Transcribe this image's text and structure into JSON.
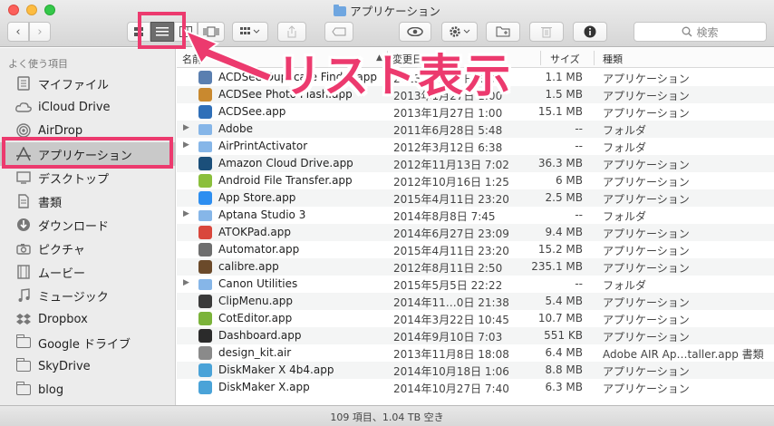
{
  "window": {
    "title": "アプリケーション"
  },
  "toolbar": {
    "search_placeholder": "検索",
    "back_glyph": "‹",
    "forward_glyph": "›",
    "view_modes": [
      "icon",
      "list",
      "column",
      "cover-flow"
    ],
    "active_view": "list"
  },
  "sidebar": {
    "heading": "よく使う項目",
    "items": [
      {
        "label": "マイファイル",
        "icon": "all-files-icon"
      },
      {
        "label": "iCloud Drive",
        "icon": "cloud-icon"
      },
      {
        "label": "AirDrop",
        "icon": "airdrop-icon"
      },
      {
        "label": "アプリケーション",
        "icon": "applications-icon",
        "selected": true
      },
      {
        "label": "デスクトップ",
        "icon": "desktop-icon"
      },
      {
        "label": "書類",
        "icon": "documents-icon"
      },
      {
        "label": "ダウンロード",
        "icon": "downloads-icon"
      },
      {
        "label": "ピクチャ",
        "icon": "camera-icon"
      },
      {
        "label": "ムービー",
        "icon": "film-icon"
      },
      {
        "label": "ミュージック",
        "icon": "music-icon"
      },
      {
        "label": "Dropbox",
        "icon": "dropbox-icon"
      },
      {
        "label": "Google ドライブ",
        "icon": "folder-icon"
      },
      {
        "label": "SkyDrive",
        "icon": "folder-icon"
      },
      {
        "label": "blog",
        "icon": "folder-icon"
      }
    ]
  },
  "columns": {
    "name": "名前",
    "date": "変更日",
    "size": "サイズ",
    "kind": "種類"
  },
  "files": [
    {
      "name": "ACDSee Duplicate Finder.app",
      "date": "2013年1月27日 1:00",
      "size": "1.1 MB",
      "kind": "アプリケーション",
      "icon": "#5a7fb0",
      "folder": false
    },
    {
      "name": "ACDSee Photo Flash.app",
      "date": "2013年1月27日 1:00",
      "size": "1.5 MB",
      "kind": "アプリケーション",
      "icon": "#c9892f",
      "folder": false
    },
    {
      "name": "ACDSee.app",
      "date": "2013年1月27日 1:00",
      "size": "15.1 MB",
      "kind": "アプリケーション",
      "icon": "#2f6fb8",
      "folder": false
    },
    {
      "name": "Adobe",
      "date": "2011年6月28日 5:48",
      "size": "--",
      "kind": "フォルダ",
      "folder": true
    },
    {
      "name": "AirPrintActivator",
      "date": "2012年3月12日 6:38",
      "size": "--",
      "kind": "フォルダ",
      "folder": true
    },
    {
      "name": "Amazon Cloud Drive.app",
      "date": "2012年11月13日 7:02",
      "size": "36.3 MB",
      "kind": "アプリケーション",
      "icon": "#1b4f7a",
      "folder": false
    },
    {
      "name": "Android File Transfer.app",
      "date": "2012年10月16日 1:25",
      "size": "6 MB",
      "kind": "アプリケーション",
      "icon": "#8bbf3c",
      "folder": false
    },
    {
      "name": "App Store.app",
      "date": "2015年4月11日 23:20",
      "size": "2.5 MB",
      "kind": "アプリケーション",
      "icon": "#2d8ef0",
      "folder": false
    },
    {
      "name": "Aptana Studio 3",
      "date": "2014年8月8日 7:45",
      "size": "--",
      "kind": "フォルダ",
      "folder": true
    },
    {
      "name": "ATOKPad.app",
      "date": "2014年6月27日 23:09",
      "size": "9.4 MB",
      "kind": "アプリケーション",
      "icon": "#d9473c",
      "folder": false
    },
    {
      "name": "Automator.app",
      "date": "2015年4月11日 23:20",
      "size": "15.2 MB",
      "kind": "アプリケーション",
      "icon": "#6e6e6e",
      "folder": false
    },
    {
      "name": "calibre.app",
      "date": "2012年8月11日 2:50",
      "size": "235.1 MB",
      "kind": "アプリケーション",
      "icon": "#6b4a2a",
      "folder": false
    },
    {
      "name": "Canon Utilities",
      "date": "2015年5月5日 22:22",
      "size": "--",
      "kind": "フォルダ",
      "folder": true
    },
    {
      "name": "ClipMenu.app",
      "date": "2014年11…0日 21:38",
      "size": "5.4 MB",
      "kind": "アプリケーション",
      "icon": "#3a3a3a",
      "folder": false
    },
    {
      "name": "CotEditor.app",
      "date": "2014年3月22日 10:45",
      "size": "10.7 MB",
      "kind": "アプリケーション",
      "icon": "#7bb33a",
      "folder": false
    },
    {
      "name": "Dashboard.app",
      "date": "2014年9月10日 7:03",
      "size": "551 KB",
      "kind": "アプリケーション",
      "icon": "#2b2b2b",
      "folder": false
    },
    {
      "name": "design_kit.air",
      "date": "2013年11月8日 18:08",
      "size": "6.4 MB",
      "kind": "Adobe AIR Ap…taller.app 書類",
      "icon": "#8a8a8a",
      "folder": false
    },
    {
      "name": "DiskMaker X 4b4.app",
      "date": "2014年10月18日 1:06",
      "size": "8.8 MB",
      "kind": "アプリケーション",
      "icon": "#4aa3d8",
      "folder": false
    },
    {
      "name": "DiskMaker X.app",
      "date": "2014年10月27日 7:40",
      "size": "6.3 MB",
      "kind": "アプリケーション",
      "icon": "#4aa3d8",
      "folder": false
    }
  ],
  "status": "109 項目、1.04 TB 空き",
  "annotation": {
    "text": "リスト表示",
    "color": "#ec3a6e"
  }
}
